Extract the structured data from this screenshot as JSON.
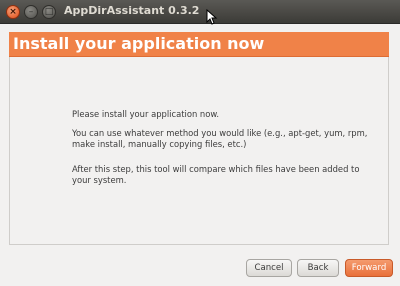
{
  "window": {
    "title": "AppDirAssistant 0.3.2",
    "close_glyph": "×",
    "minimize_glyph": "–",
    "maximize_glyph": "□"
  },
  "banner": {
    "heading": "Install your application now",
    "color": "#f08248"
  },
  "content": {
    "paragraph_1": "Please install your application now.",
    "paragraph_2": "You can use whatever method you would like (e.g., apt-get, yum, rpm, make install, manually copying files, etc.)",
    "paragraph_3": "After this step, this tool will compare which files have been added to your system."
  },
  "buttons": {
    "cancel": "Cancel",
    "back": "Back",
    "forward": "Forward"
  },
  "colors": {
    "titlebar": "#3c3b37",
    "accent": "#e9703a",
    "background": "#f2f1f0"
  }
}
